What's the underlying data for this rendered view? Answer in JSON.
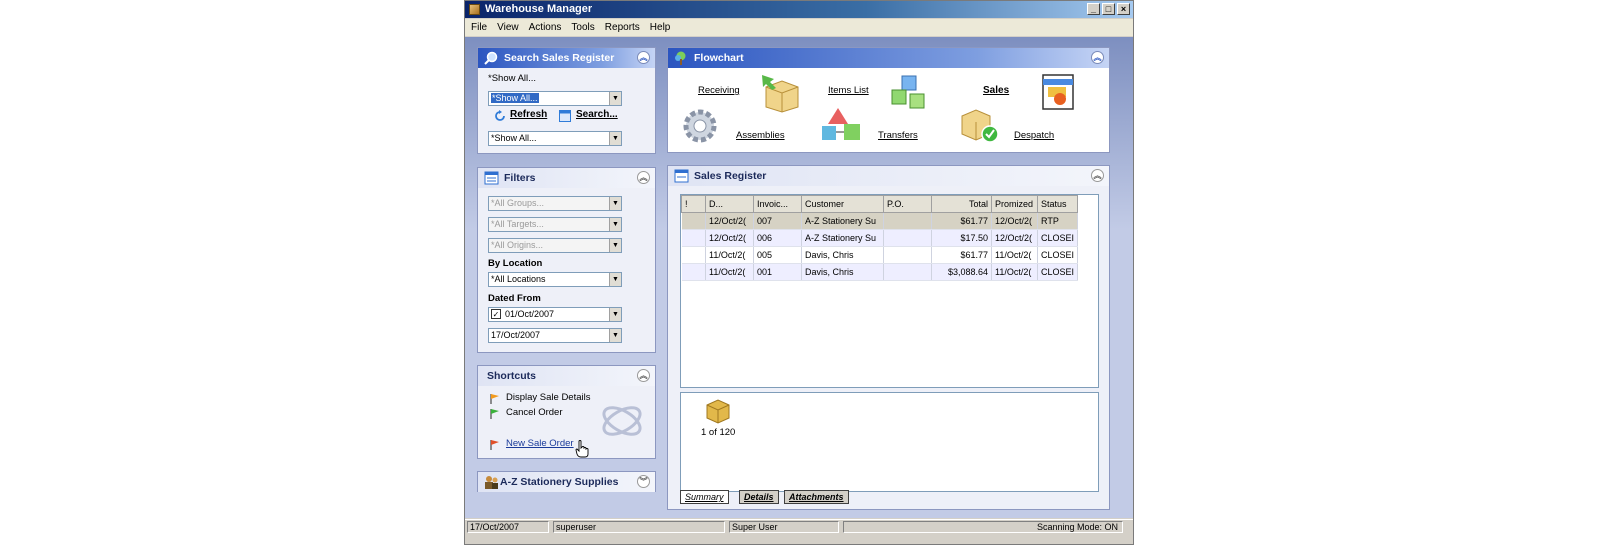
{
  "window": {
    "title": "Warehouse Manager",
    "buttons": [
      "_",
      "□",
      "×"
    ]
  },
  "menu": [
    "File",
    "View",
    "Actions",
    "Tools",
    "Reports",
    "Help"
  ],
  "search_panel": {
    "title": "Search Sales Register",
    "show_all_label": "*Show All...",
    "combo1": "*Show All...",
    "refresh": "Refresh",
    "search": "Search...",
    "combo2": "*Show All..."
  },
  "filters_panel": {
    "title": "Filters",
    "groups": "*All Groups...",
    "targets": "*All Targets...",
    "origins": "*All Origins...",
    "by_location_label": "By Location",
    "location": "*All Locations",
    "dated_from_label": "Dated From",
    "date_from": "01/Oct/2007",
    "date_to": "17/Oct/2007"
  },
  "shortcuts_panel": {
    "title": "Shortcuts",
    "items": [
      "Display Sale Details",
      "Cancel Order",
      "New Sale Order"
    ]
  },
  "company_panel": {
    "title": "A-Z Stationery Supplies"
  },
  "flowchart": {
    "title": "Flowchart",
    "receiving": "Receiving",
    "items_list": "Items List",
    "sales": "Sales",
    "assemblies": "Assemblies",
    "transfers": "Transfers",
    "despatch": "Despatch"
  },
  "sales_register": {
    "title": "Sales Register",
    "columns": [
      "!",
      "D...",
      "Invoic...",
      "Customer",
      "P.O.",
      "Total",
      "Promized",
      "Status"
    ],
    "rows": [
      [
        "",
        "12/Oct/2(",
        "007",
        "A-Z Stationery Su",
        "",
        "$61.77",
        "12/Oct/2(",
        "RTP"
      ],
      [
        "",
        "12/Oct/2(",
        "006",
        "A-Z Stationery Su",
        "",
        "$17.50",
        "12/Oct/2(",
        "CLOSEI"
      ],
      [
        "",
        "11/Oct/2(",
        "005",
        "Davis, Chris",
        "",
        "$61.77",
        "11/Oct/2(",
        "CLOSEI"
      ],
      [
        "",
        "11/Oct/2(",
        "001",
        "Davis, Chris",
        "",
        "$3,088.64",
        "11/Oct/2(",
        "CLOSEI"
      ]
    ],
    "record_count": "1 of 120",
    "tabs": [
      "Summary",
      "Details",
      "Attachments"
    ]
  },
  "status": {
    "date": "17/Oct/2007",
    "user": "superuser",
    "role": "Super User",
    "mode": "Scanning Mode: ON"
  }
}
